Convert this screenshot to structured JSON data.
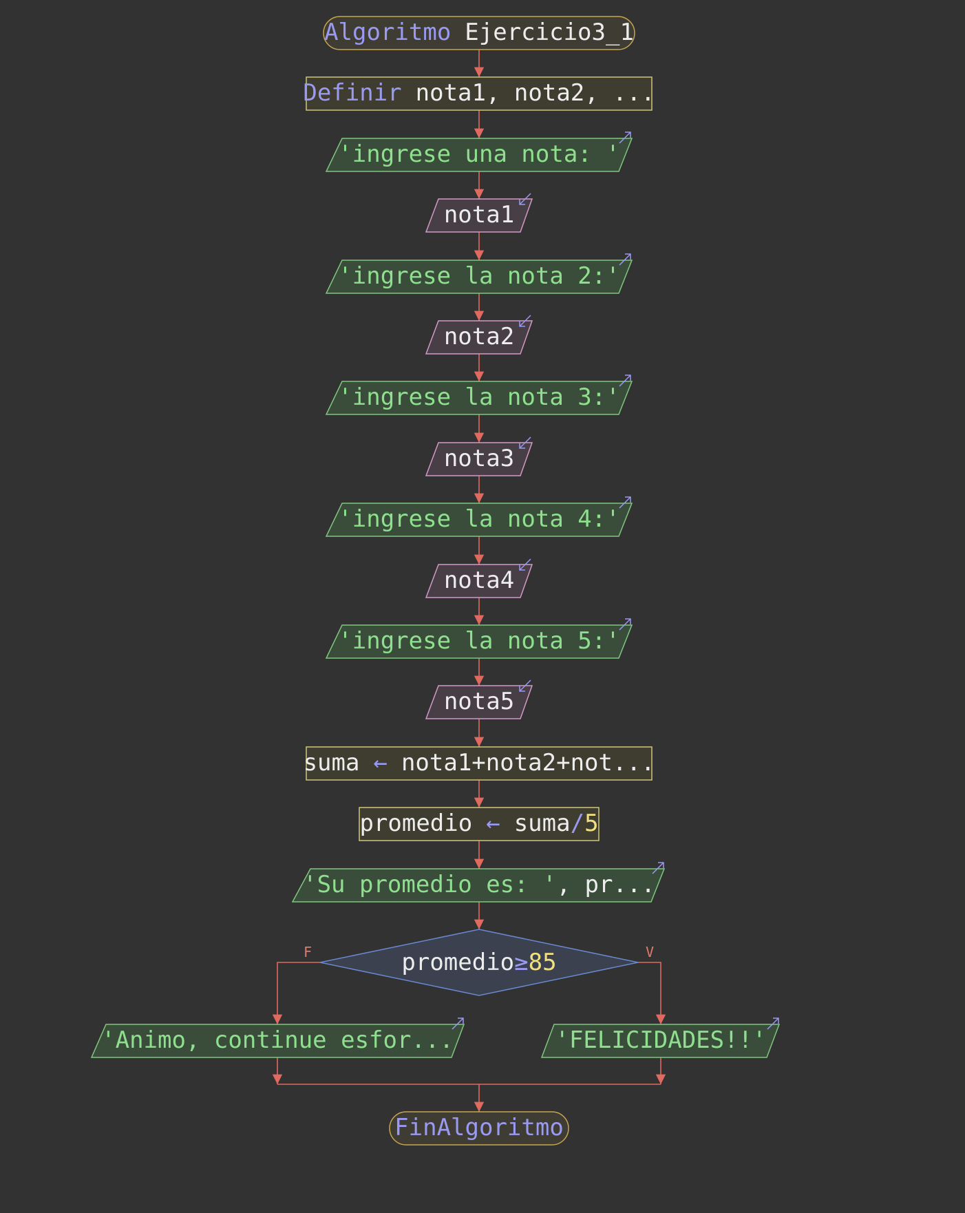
{
  "diagram": {
    "start": {
      "keyword": "Algoritmo",
      "name": "Ejercicio3_1"
    },
    "define": {
      "keyword": "Definir",
      "vars": "nota1, nota2, ..."
    },
    "prompt1": "'ingrese una nota: '",
    "read1": "nota1",
    "prompt2": "'ingrese la nota 2:'",
    "read2": "nota2",
    "prompt3": "'ingrese la nota 3:'",
    "read3": "nota3",
    "prompt4": "'ingrese la nota 4:'",
    "read4": "nota4",
    "prompt5": "'ingrese la nota 5:'",
    "read5": "nota5",
    "sum": {
      "target": "suma",
      "arrow": "←",
      "expr": "nota1+nota2+not..."
    },
    "avg": {
      "target": "promedio",
      "arrow": "←",
      "lhs": "suma",
      "op": "/",
      "divisor": "5"
    },
    "output_avg": {
      "string": "'Su promedio es: '",
      "rest": ", pr..."
    },
    "decision": {
      "var": "promedio",
      "op": "≥",
      "value": "85"
    },
    "false_label": "F",
    "true_label": "V",
    "false_output": "'Animo, continue esfor...",
    "true_output": "'FELICIDADES!!'",
    "end": "FinAlgoritmo"
  },
  "colors": {
    "background": "#323232",
    "keyword": "#9a9af2",
    "identifier": "#ededed",
    "string": "#8ee08e",
    "number": "#f0e080",
    "edge": "#e06a60",
    "terminal_fill": "#3f3c34",
    "terminal_stroke": "#c7a650",
    "process_fill": "#3e3d30",
    "process_stroke": "#cfc77a",
    "output_fill": "#3a4d3a",
    "output_stroke": "#7fc77f",
    "input_fill": "#483e46",
    "input_stroke": "#d49ac6",
    "decision_fill": "#3c4150",
    "decision_stroke": "#6a88d0"
  }
}
